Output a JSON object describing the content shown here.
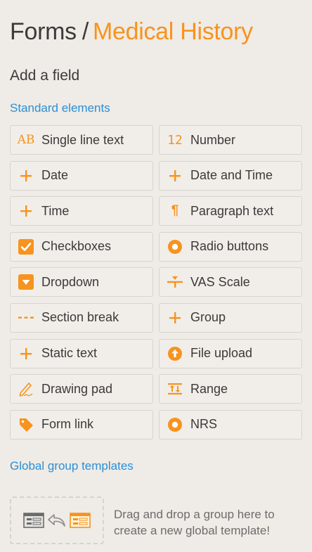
{
  "header": {
    "crumb": "Forms",
    "separator": "/",
    "current": "Medical History"
  },
  "subtitle": "Add a field",
  "standard": {
    "heading": "Standard elements",
    "items": [
      {
        "label": "Single line text",
        "icon": "ab-text-icon"
      },
      {
        "label": "Number",
        "icon": "number-icon"
      },
      {
        "label": "Date",
        "icon": "plus-icon"
      },
      {
        "label": "Date and Time",
        "icon": "plus-icon"
      },
      {
        "label": "Time",
        "icon": "plus-icon"
      },
      {
        "label": "Paragraph text",
        "icon": "paragraph-icon"
      },
      {
        "label": "Checkboxes",
        "icon": "checkbox-icon"
      },
      {
        "label": "Radio buttons",
        "icon": "radio-icon"
      },
      {
        "label": "Dropdown",
        "icon": "dropdown-icon"
      },
      {
        "label": "VAS Scale",
        "icon": "vas-scale-icon"
      },
      {
        "label": "Section break",
        "icon": "section-break-icon"
      },
      {
        "label": "Group",
        "icon": "plus-icon"
      },
      {
        "label": "Static text",
        "icon": "plus-icon"
      },
      {
        "label": "File upload",
        "icon": "upload-icon"
      },
      {
        "label": "Drawing pad",
        "icon": "pen-icon"
      },
      {
        "label": "Range",
        "icon": "range-icon"
      },
      {
        "label": "Form link",
        "icon": "tag-icon"
      },
      {
        "label": "NRS",
        "icon": "radio-icon"
      }
    ]
  },
  "global": {
    "heading": "Global group templates",
    "dropzone_text": "Drag and drop a group here to create a new global template!"
  },
  "colors": {
    "accent": "#f7931e",
    "link": "#2b8fd6",
    "background": "#efebe6"
  }
}
